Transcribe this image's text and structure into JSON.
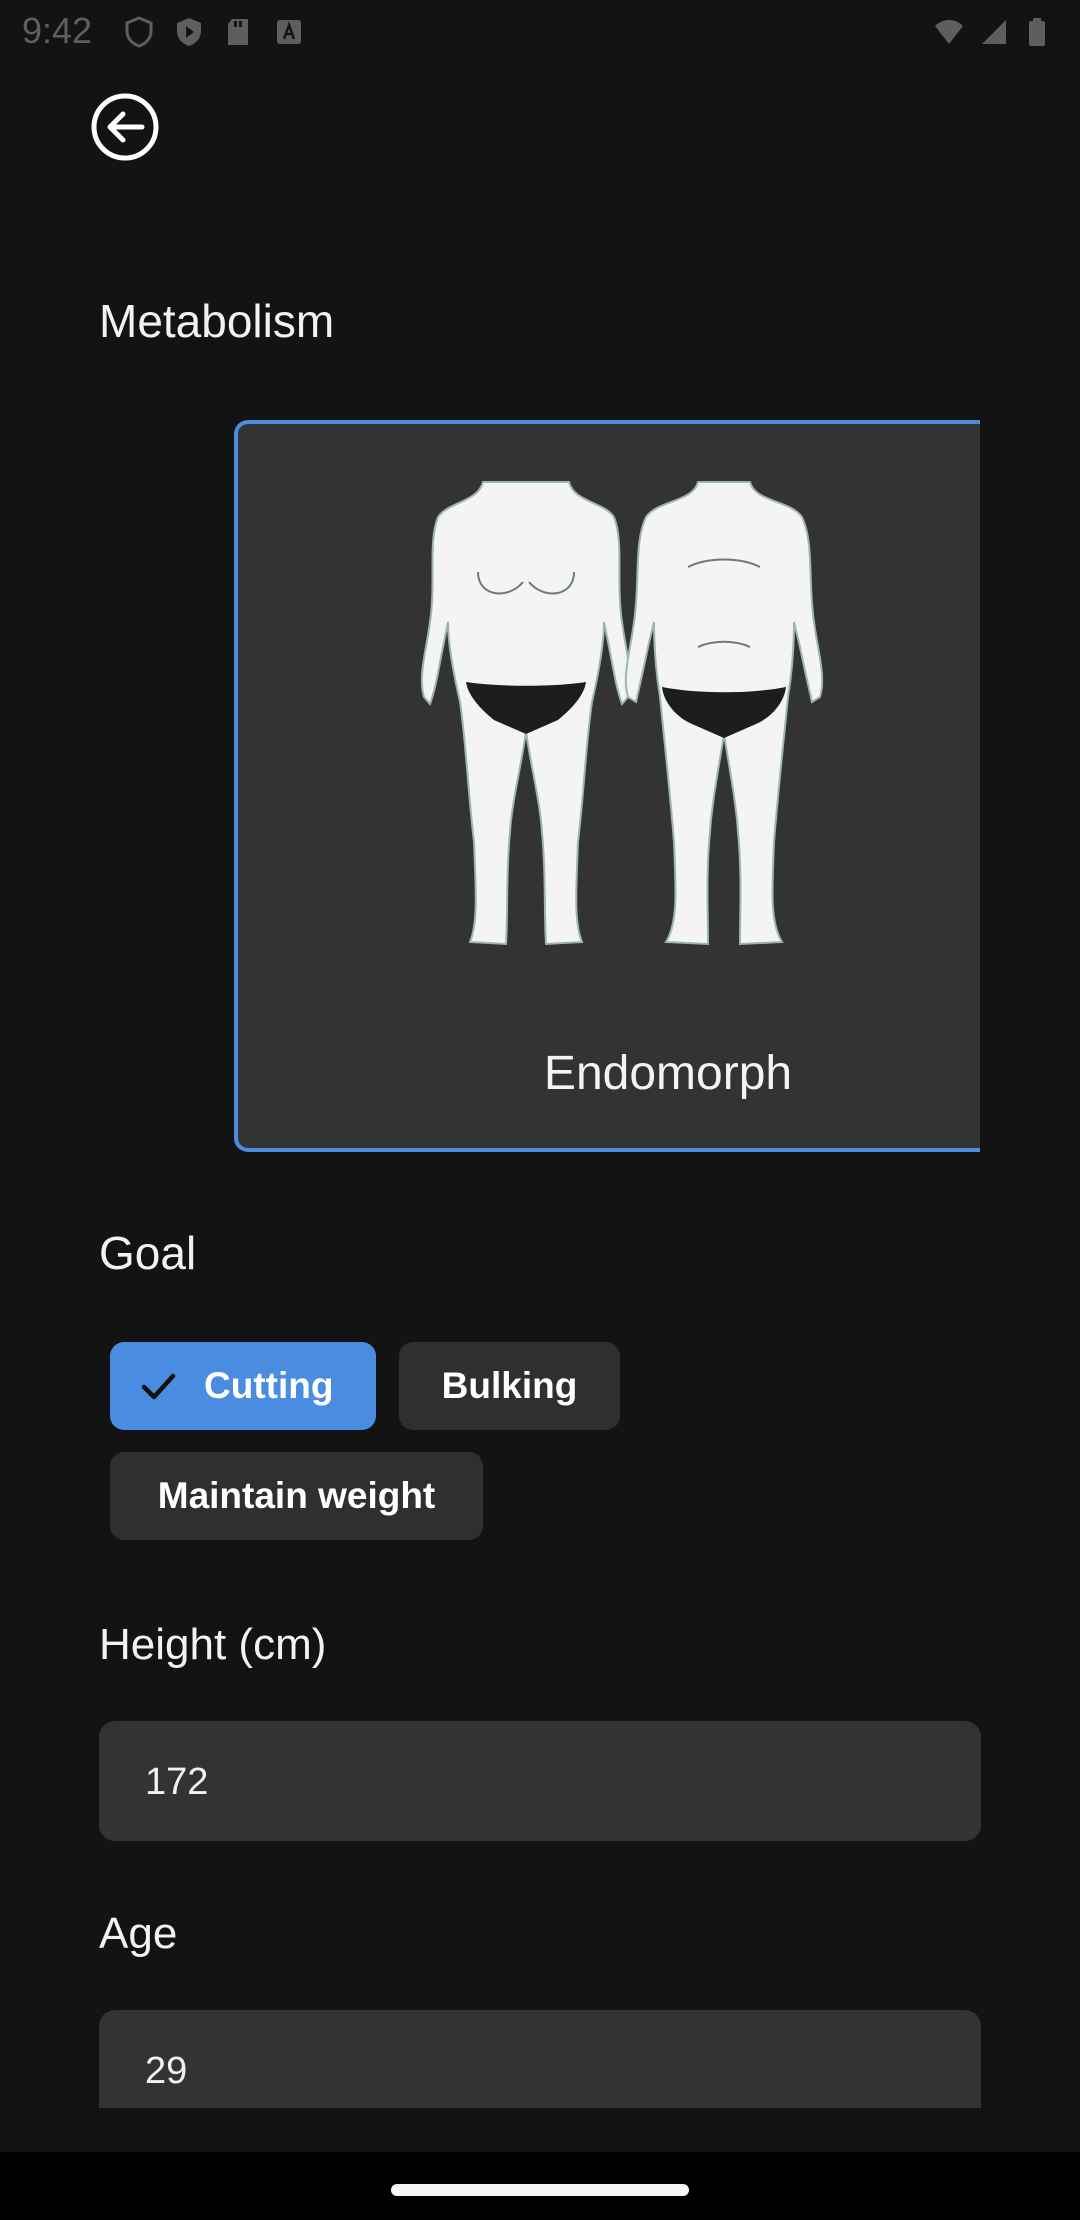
{
  "status_bar": {
    "time": "9:42"
  },
  "header": {
    "back_icon": "arrow-left-circle-icon"
  },
  "metabolism": {
    "title": "Metabolism",
    "selected_card": {
      "label": "Endomorph",
      "selected": true
    }
  },
  "goal": {
    "title": "Goal",
    "options": [
      {
        "label": "Cutting",
        "selected": true
      },
      {
        "label": "Bulking",
        "selected": false
      },
      {
        "label": "Maintain weight",
        "selected": false
      }
    ]
  },
  "height": {
    "label": "Height (cm)",
    "value": "172"
  },
  "age": {
    "label": "Age",
    "value": "29"
  },
  "colors": {
    "accent": "#4a8ce0",
    "background": "#131313",
    "surface": "#333333"
  }
}
